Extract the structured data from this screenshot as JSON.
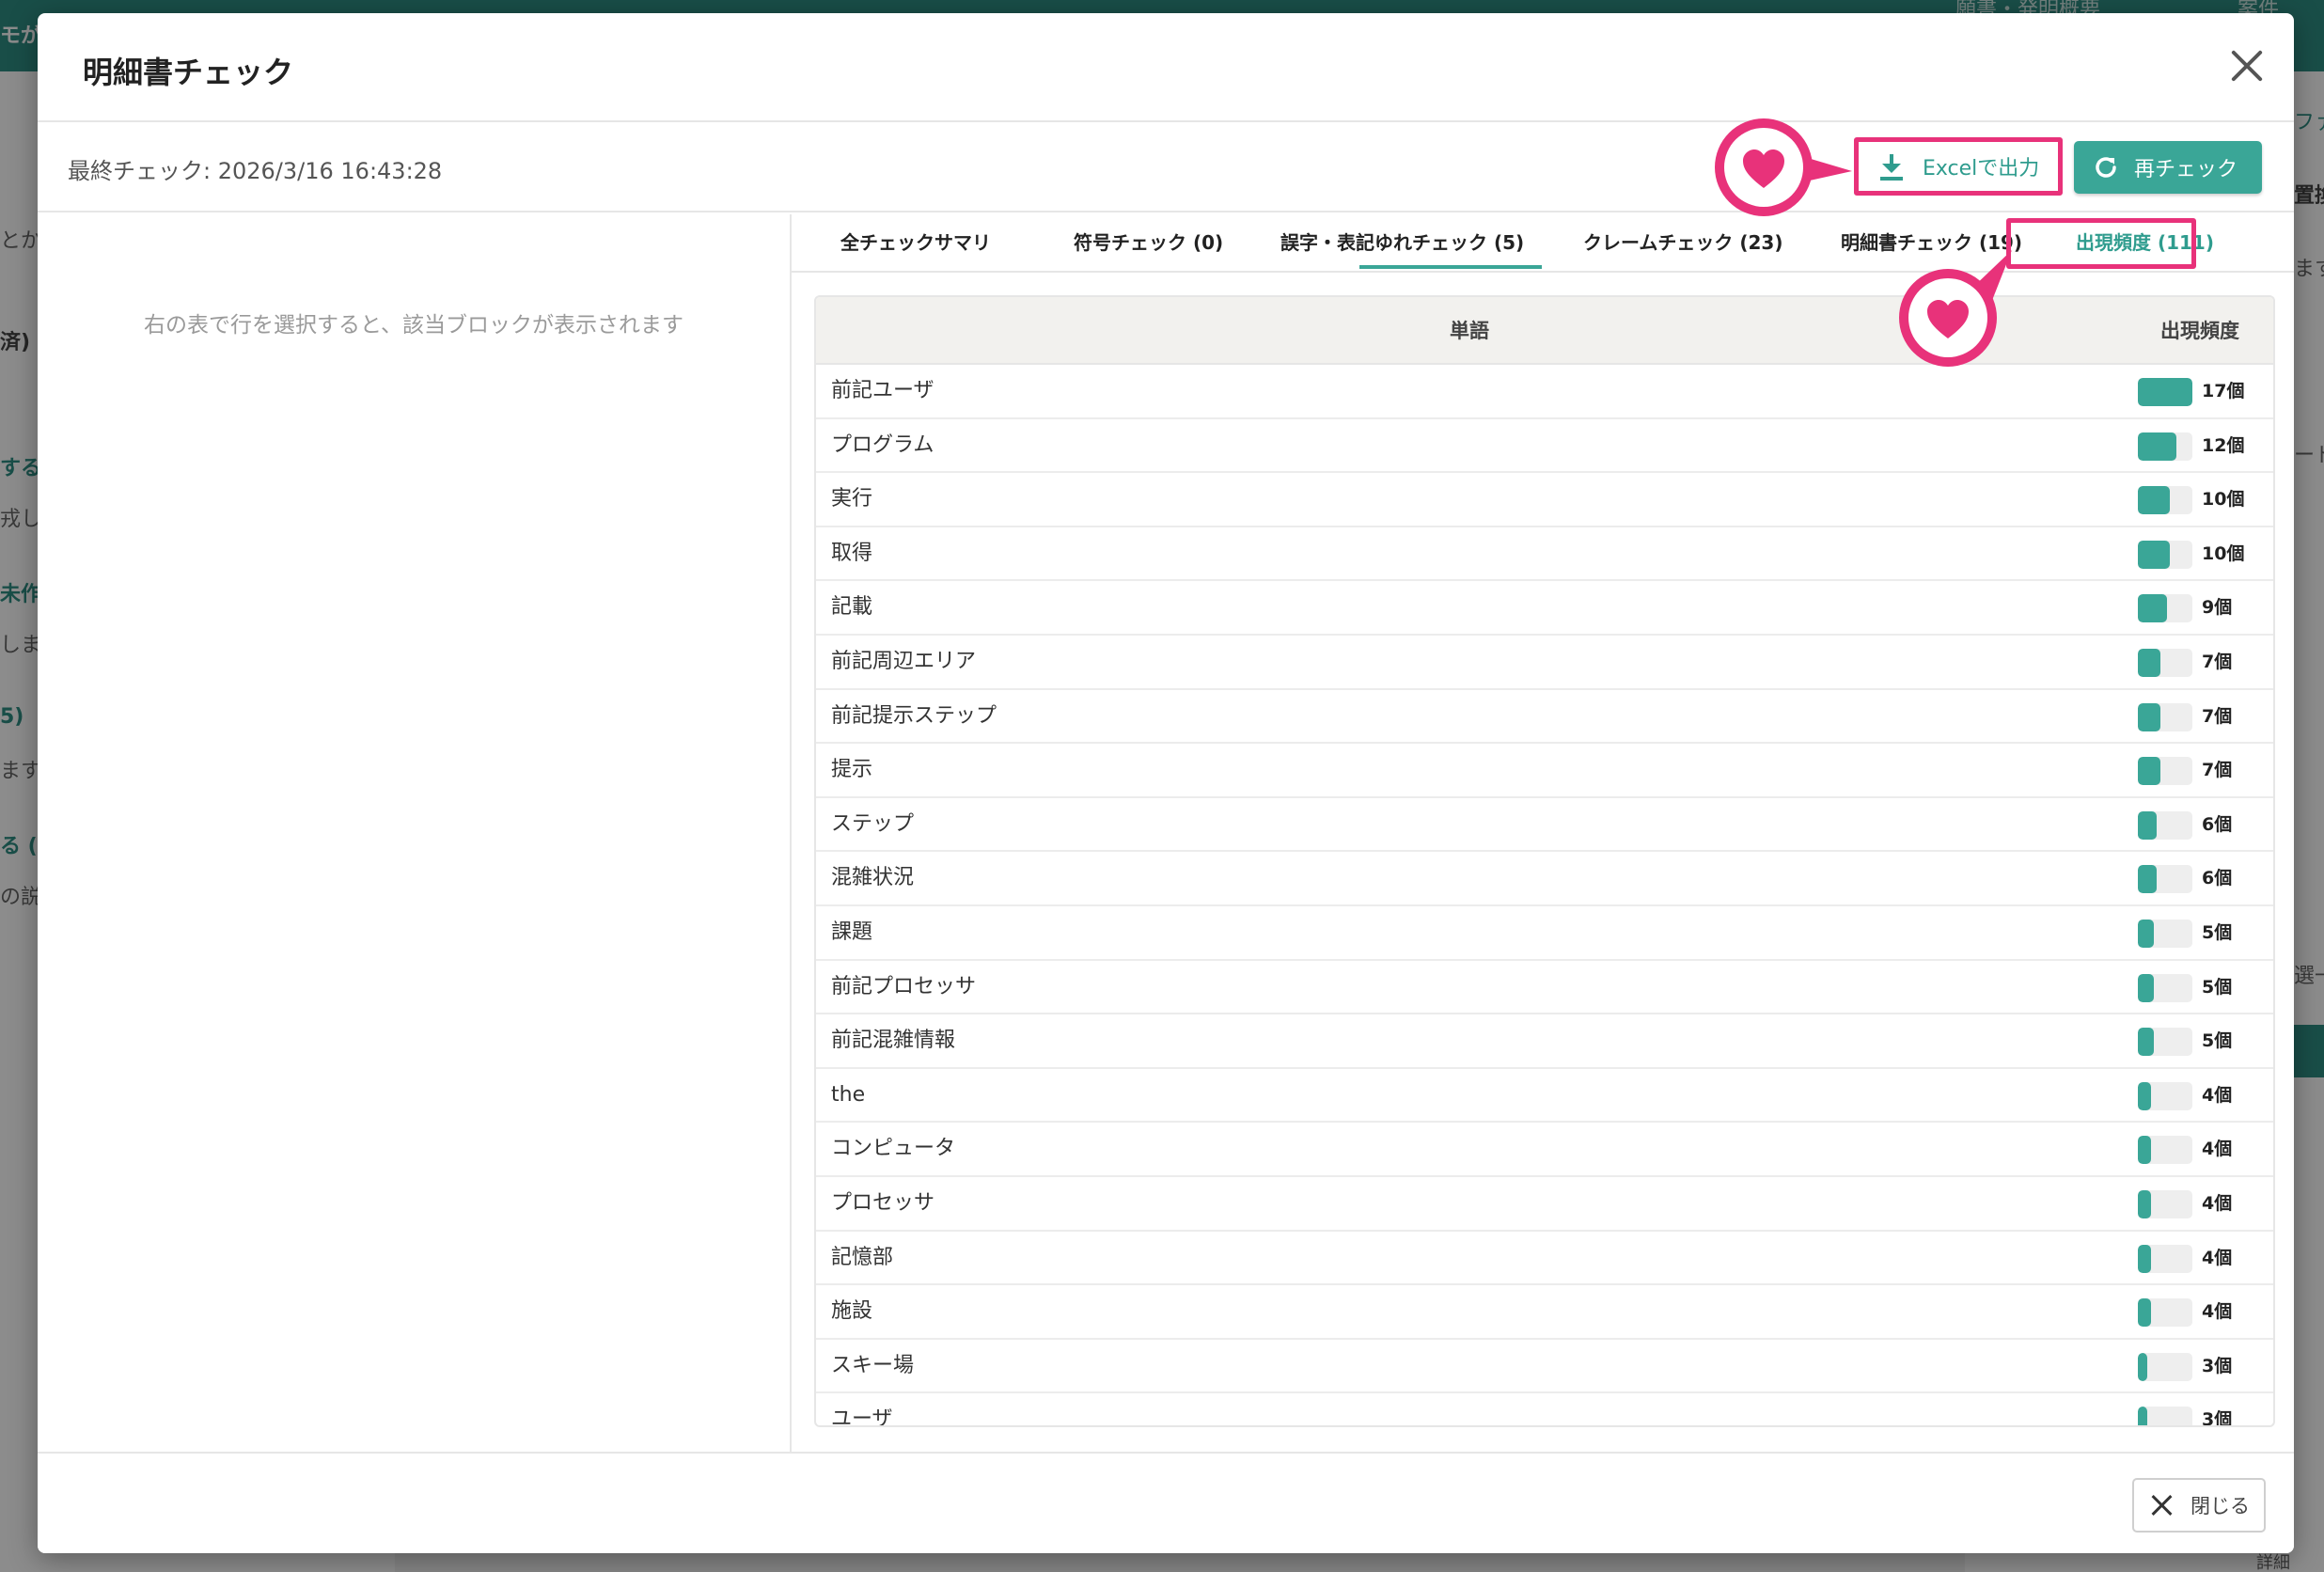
{
  "modal": {
    "title": "明細書チェック",
    "last_check": "最終チェック: 2026/3/16 16:43:28",
    "export_label": "Excelで出力",
    "recheck_label": "再チェック",
    "left_hint": "右の表で行を選択すると、該当ブロックが表示されます",
    "close_label": "閉じる"
  },
  "tabs": [
    {
      "label": "全チェックサマリ"
    },
    {
      "label": "符号チェック (0)"
    },
    {
      "label": "誤字・表記ゆれチェック (5)"
    },
    {
      "label": "クレームチェック (23)"
    },
    {
      "label": "明細書チェック (19)"
    },
    {
      "label": "出現頻度 (111)",
      "active": true
    }
  ],
  "table": {
    "header_word": "単語",
    "header_freq": "出現頻度",
    "max_count": 17,
    "rows": [
      {
        "word": "前記ユーザ",
        "count": 17,
        "count_label": "17個"
      },
      {
        "word": "プログラム",
        "count": 12,
        "count_label": "12個"
      },
      {
        "word": "実行",
        "count": 10,
        "count_label": "10個"
      },
      {
        "word": "取得",
        "count": 10,
        "count_label": "10個"
      },
      {
        "word": "記載",
        "count": 9,
        "count_label": "9個"
      },
      {
        "word": "前記周辺エリア",
        "count": 7,
        "count_label": "7個"
      },
      {
        "word": "前記提示ステップ",
        "count": 7,
        "count_label": "7個"
      },
      {
        "word": "提示",
        "count": 7,
        "count_label": "7個"
      },
      {
        "word": "ステップ",
        "count": 6,
        "count_label": "6個"
      },
      {
        "word": "混雑状況",
        "count": 6,
        "count_label": "6個"
      },
      {
        "word": "課題",
        "count": 5,
        "count_label": "5個"
      },
      {
        "word": "前記プロセッサ",
        "count": 5,
        "count_label": "5個"
      },
      {
        "word": "前記混雑情報",
        "count": 5,
        "count_label": "5個"
      },
      {
        "word": "the",
        "count": 4,
        "count_label": "4個"
      },
      {
        "word": "コンピュータ",
        "count": 4,
        "count_label": "4個"
      },
      {
        "word": "プロセッサ",
        "count": 4,
        "count_label": "4個"
      },
      {
        "word": "記憶部",
        "count": 4,
        "count_label": "4個"
      },
      {
        "word": "施設",
        "count": 4,
        "count_label": "4個"
      },
      {
        "word": "スキー場",
        "count": 3,
        "count_label": "3個"
      },
      {
        "word": "ユーザ",
        "count": 3,
        "count_label": "3個"
      }
    ]
  },
  "background": {
    "fragments": [
      "モが",
      "とか",
      "済)",
      "する",
      "戎し",
      "未作",
      "しま",
      "5)",
      "ます",
      "る (未",
      "の説明",
      "置換",
      "ます",
      "ード",
      "選一",
      "ファ",
      "願書・発明概要",
      "案件",
      "詳細"
    ]
  },
  "colors": {
    "accent": "#3aa697",
    "highlight": "#e8327a",
    "bar_track": "#eeeeee"
  }
}
